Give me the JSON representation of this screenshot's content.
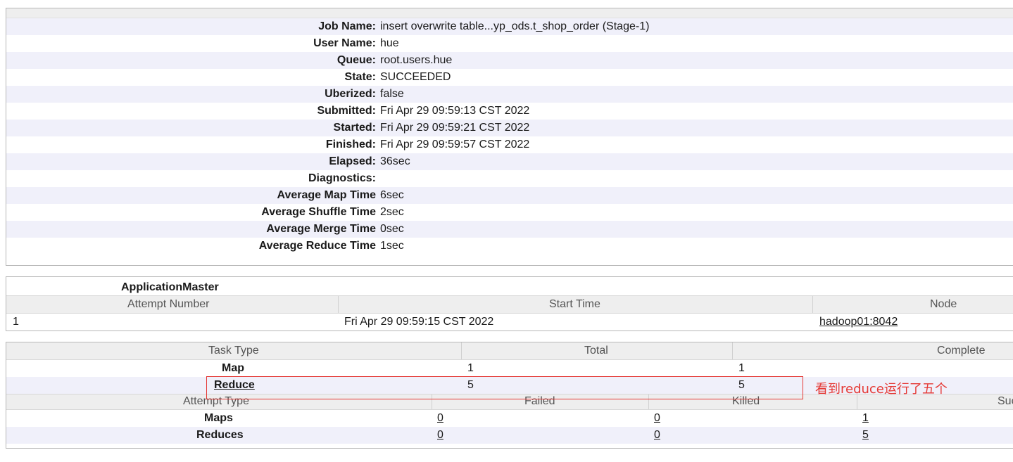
{
  "job": {
    "rows": [
      {
        "label": "Job Name:",
        "value": "insert overwrite table...yp_ods.t_shop_order (Stage-1)"
      },
      {
        "label": "User Name:",
        "value": "hue"
      },
      {
        "label": "Queue:",
        "value": "root.users.hue"
      },
      {
        "label": "State:",
        "value": "SUCCEEDED"
      },
      {
        "label": "Uberized:",
        "value": "false"
      },
      {
        "label": "Submitted:",
        "value": "Fri Apr 29 09:59:13 CST 2022"
      },
      {
        "label": "Started:",
        "value": "Fri Apr 29 09:59:21 CST 2022"
      },
      {
        "label": "Finished:",
        "value": "Fri Apr 29 09:59:57 CST 2022"
      },
      {
        "label": "Elapsed:",
        "value": "36sec"
      },
      {
        "label": "Diagnostics:",
        "value": ""
      },
      {
        "label": "Average Map Time",
        "value": "6sec"
      },
      {
        "label": "Average Shuffle Time",
        "value": "2sec"
      },
      {
        "label": "Average Merge Time",
        "value": "0sec"
      },
      {
        "label": "Average Reduce Time",
        "value": "1sec"
      }
    ]
  },
  "app_master": {
    "title": "ApplicationMaster",
    "headers": {
      "attempt": "Attempt Number",
      "start": "Start Time",
      "node": "Node"
    },
    "row": {
      "attempt": "1",
      "start": "Fri Apr 29 09:59:15 CST 2022",
      "node": "hadoop01:8042"
    }
  },
  "tasks": {
    "headers": {
      "type": "Task Type",
      "total": "Total",
      "complete": "Complete"
    },
    "map": {
      "type": "Map",
      "total": "1",
      "complete": "1"
    },
    "reduce": {
      "type": "Reduce",
      "total": "5",
      "complete": "5"
    }
  },
  "attempts": {
    "headers": {
      "type": "Attempt Type",
      "failed": "Failed",
      "killed": "Killed",
      "successful": "Suc"
    },
    "maps": {
      "type": "Maps",
      "failed": "0",
      "killed": "0",
      "successful": "1"
    },
    "reduces": {
      "type": "Reduces",
      "failed": "0",
      "killed": "0",
      "successful": "5"
    }
  },
  "annotation": {
    "text": "看到reduce运行了五个",
    "color": "#e53935"
  }
}
